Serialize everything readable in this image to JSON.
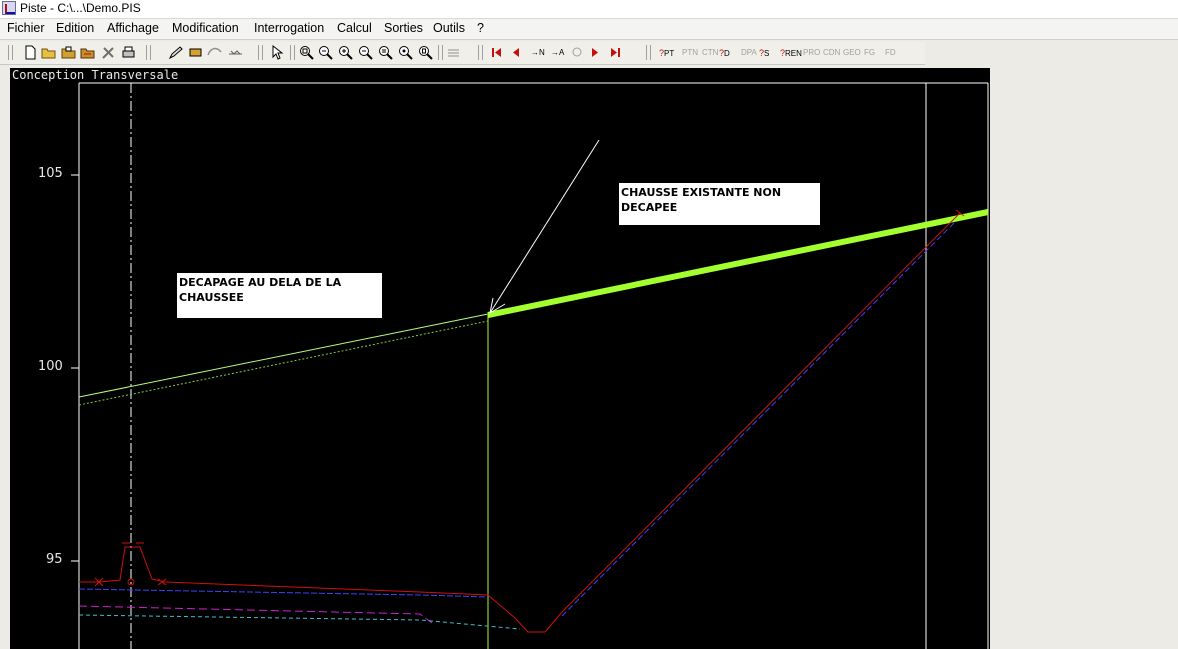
{
  "window": {
    "title": "Piste - C:\\...\\Demo.PIS"
  },
  "menu": {
    "items": [
      "Fichier",
      "Edition",
      "Affichage",
      "Modification",
      "Interrogation",
      "Calcul",
      "Sorties",
      "Outils",
      "?"
    ]
  },
  "toolbar": {
    "groups": [
      {
        "name": "file",
        "icons": [
          "new-file-icon",
          "open-folder-icon",
          "open-project-icon",
          "open-alt-icon",
          "tools-icon",
          "print-icon"
        ]
      },
      {
        "name": "edit",
        "icons": [
          "pen-icon",
          "ruler-icon",
          "curve-icon",
          "profile-icon"
        ]
      },
      {
        "name": "pointer",
        "icons": [
          "pointer-icon"
        ]
      },
      {
        "name": "zoom",
        "icons": [
          "zoom-window-icon",
          "zoom-out-icon",
          "zoom-in-icon",
          "zoom-previous-icon",
          "zoom-extents-icon",
          "zoom-all-icon",
          "zoom-page-icon"
        ]
      },
      {
        "name": "layers",
        "icons": [
          "layers-icon"
        ]
      },
      {
        "name": "navigation",
        "labels": [
          "N",
          "A"
        ],
        "icons": [
          "first-icon",
          "previous-icon",
          "goto-n-icon",
          "goto-a-icon",
          "search-profile-icon",
          "next-icon",
          "last-icon"
        ]
      },
      {
        "name": "queries",
        "labels": [
          "PT",
          "PTN",
          "CTN",
          "D",
          "DPA",
          "S",
          "REN",
          "PRO",
          "CDN",
          "GEO",
          "FG",
          "FD"
        ]
      }
    ]
  },
  "drawing": {
    "title": "Conception Transversale",
    "y_ticks": [
      "105",
      "100",
      "95"
    ],
    "annotations": [
      {
        "id": "decapage",
        "text": "DECAPAGE AU DELA DE LA\nCHAUSSEE"
      },
      {
        "id": "chaussee",
        "text": "CHAUSSE EXISTANTE NON\nDECAPEE"
      }
    ],
    "colors": {
      "background": "#000000",
      "frame": "#ffffff",
      "terrain_existing": "#a4ff2e",
      "terrain_stripped": "#7fcf40",
      "project_line": "#d01010",
      "sub_line_blue": "#4040ff",
      "sub_line_magenta": "#d020d0",
      "sub_line_cyan": "#40c0d0"
    }
  }
}
